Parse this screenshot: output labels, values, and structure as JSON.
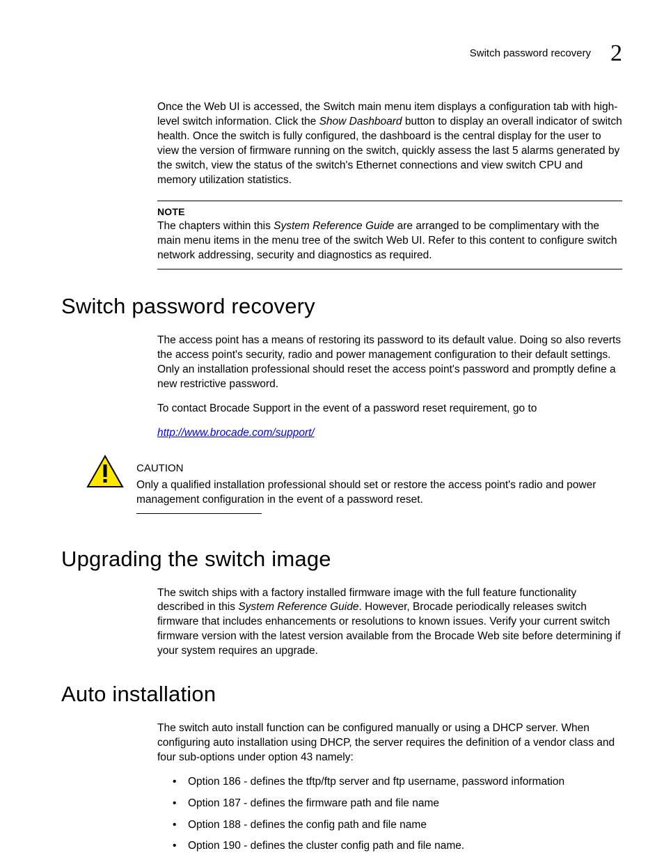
{
  "header": {
    "running_title": "Switch password recovery",
    "chapter_number": "2"
  },
  "intro": {
    "p1_a": "Once the Web UI is accessed, the Switch main menu item displays a configuration tab with high-level switch information. Click the ",
    "p1_i": "Show Dashboard",
    "p1_b": " button to display an overall indicator of switch health. Once the switch is fully configured, the dashboard is the central display for the user to view the version of firmware running on the switch, quickly assess the last 5 alarms generated by the switch, view the status of the switch's Ethernet connections and view switch CPU and memory utilization statistics."
  },
  "note": {
    "label": "NOTE",
    "body_a": "The chapters within this ",
    "body_i": "System Reference Guide",
    "body_b": " are arranged to be complimentary with the main menu items in the menu tree of the switch Web UI. Refer to this content to configure switch network addressing, security and diagnostics as required."
  },
  "s1": {
    "title": "Switch password recovery",
    "p1": "The access point has a means of restoring its password to its default value. Doing so also reverts the access point's security, radio and power management configuration to their default settings. Only an installation professional should reset the access point's password and promptly define a new restrictive password.",
    "p2": "To contact Brocade Support in the event of a password reset requirement, go to",
    "link_text": "http://www.brocade.com/support/",
    "link_href": "http://www.brocade.com/support/"
  },
  "caution": {
    "label": "CAUTION",
    "body": "Only a qualified installation professional should set or restore the access point's radio and power management configuration in the event of a password reset."
  },
  "s2": {
    "title": "Upgrading the switch image",
    "p1_a": "The switch ships with a factory installed firmware image with the full feature functionality described in this ",
    "p1_i": "System Reference Guide",
    "p1_b": ". However, Brocade periodically releases switch firmware that includes enhancements or resolutions to known issues. Verify your current switch firmware version with the latest version available from the Brocade Web site before determining if your system requires an upgrade."
  },
  "s3": {
    "title": "Auto installation",
    "p1": "The switch auto install function can be configured manually or using a DHCP server. When configuring auto installation using DHCP, the server requires the definition of a vendor class and four sub-options under option 43 namely:",
    "bullets": [
      "Option 186 - defines the tftp/ftp server and ftp username, password information",
      "Option 187 - defines the firmware path and file name",
      "Option 188 - defines the config path and file name",
      "Option 190 - defines the cluster config path and file name."
    ]
  }
}
